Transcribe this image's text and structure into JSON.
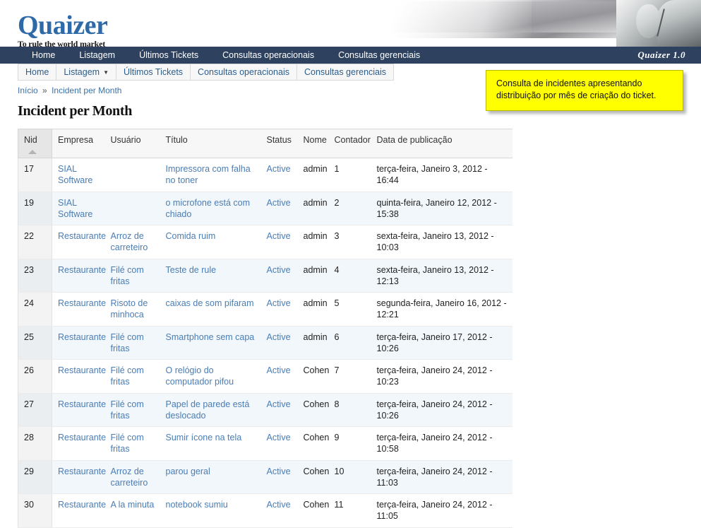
{
  "brand": {
    "name": "Quaizer",
    "tagline": "To rule the world market",
    "version_label": "Quaizer 1.0",
    "logo_color": "#2f6aa8",
    "nav_color": "#2e4260"
  },
  "banner": {
    "image_alt": "call-center-operator-headset-photo"
  },
  "primary_nav": {
    "items": [
      {
        "label": "Home"
      },
      {
        "label": "Listagem"
      },
      {
        "label": "Últimos Tickets"
      },
      {
        "label": "Consultas operacionais"
      },
      {
        "label": "Consultas gerenciais"
      }
    ]
  },
  "secondary_nav": {
    "tabs": [
      {
        "label": "Home",
        "has_caret": false
      },
      {
        "label": "Listagem",
        "has_caret": true,
        "caret": "▼"
      },
      {
        "label": "Últimos Tickets",
        "has_caret": false
      },
      {
        "label": "Consultas operacionais",
        "has_caret": false
      },
      {
        "label": "Consultas gerenciais",
        "has_caret": false
      }
    ]
  },
  "breadcrumb": {
    "home": "Início",
    "separator": "»",
    "current": "Incident per Month"
  },
  "page": {
    "title": "Incident per Month"
  },
  "tooltip": {
    "text": "Consulta de incidentes apresentando distribuição por mês de criação do ticket.",
    "background": "#ffff00"
  },
  "table": {
    "sort_column": "Nid",
    "sort_direction": "asc",
    "sort_arrow": "▲",
    "columns": [
      {
        "label": "Nid"
      },
      {
        "label": "Empresa"
      },
      {
        "label": "Usuário"
      },
      {
        "label": "Título"
      },
      {
        "label": "Status"
      },
      {
        "label": "Nome"
      },
      {
        "label": "Contador"
      },
      {
        "label": "Data de publicação"
      }
    ],
    "rows": [
      {
        "nid": "17",
        "empresa": "SIAL Software",
        "usuario": "",
        "titulo": "Impressora com falha no toner",
        "status": "Active",
        "nome": "admin",
        "contador": "1",
        "data": "terça-feira, Janeiro 3, 2012 - 16:44"
      },
      {
        "nid": "19",
        "empresa": "SIAL Software",
        "usuario": "",
        "titulo": "o microfone está com chiado",
        "status": "Active",
        "nome": "admin",
        "contador": "2",
        "data": "quinta-feira, Janeiro 12, 2012 - 15:38"
      },
      {
        "nid": "22",
        "empresa": "Restaurante",
        "usuario": "Arroz de carreteiro",
        "titulo": "Comida ruim",
        "status": "Active",
        "nome": "admin",
        "contador": "3",
        "data": "sexta-feira, Janeiro 13, 2012 - 10:03"
      },
      {
        "nid": "23",
        "empresa": "Restaurante",
        "usuario": "Filé com fritas",
        "titulo": "Teste de rule",
        "status": "Active",
        "nome": "admin",
        "contador": "4",
        "data": "sexta-feira, Janeiro 13, 2012 - 12:13"
      },
      {
        "nid": "24",
        "empresa": "Restaurante",
        "usuario": "Risoto de minhoca",
        "titulo": "caixas de som pifaram",
        "status": "Active",
        "nome": "admin",
        "contador": "5",
        "data": "segunda-feira, Janeiro 16, 2012 - 12:21"
      },
      {
        "nid": "25",
        "empresa": "Restaurante",
        "usuario": "Filé com fritas",
        "titulo": "Smartphone sem capa",
        "status": "Active",
        "nome": "admin",
        "contador": "6",
        "data": "terça-feira, Janeiro 17, 2012 - 10:26"
      },
      {
        "nid": "26",
        "empresa": "Restaurante",
        "usuario": "Filé com fritas",
        "titulo": "O relógio do computador pifou",
        "status": "Active",
        "nome": "Cohen",
        "contador": "7",
        "data": "terça-feira, Janeiro 24, 2012 - 10:23"
      },
      {
        "nid": "27",
        "empresa": "Restaurante",
        "usuario": "Filé com fritas",
        "titulo": "Papel de parede está deslocado",
        "status": "Active",
        "nome": "Cohen",
        "contador": "8",
        "data": "terça-feira, Janeiro 24, 2012 - 10:26"
      },
      {
        "nid": "28",
        "empresa": "Restaurante",
        "usuario": "Filé com fritas",
        "titulo": "Sumir ícone na tela",
        "status": "Active",
        "nome": "Cohen",
        "contador": "9",
        "data": "terça-feira, Janeiro 24, 2012 - 10:58"
      },
      {
        "nid": "29",
        "empresa": "Restaurante",
        "usuario": "Arroz de carreteiro",
        "titulo": "parou geral",
        "status": "Active",
        "nome": "Cohen",
        "contador": "10",
        "data": "terça-feira, Janeiro 24, 2012 - 11:03"
      },
      {
        "nid": "30",
        "empresa": "Restaurante",
        "usuario": "A la minuta",
        "titulo": "notebook sumiu",
        "status": "Active",
        "nome": "Cohen",
        "contador": "11",
        "data": "terça-feira, Janeiro 24, 2012 - 11:05"
      }
    ]
  }
}
